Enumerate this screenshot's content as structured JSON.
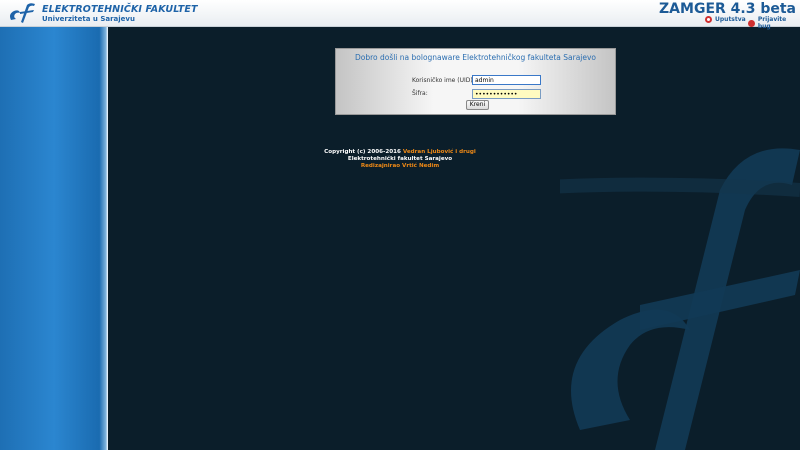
{
  "header": {
    "institution_name": "ELEKTROTEHNIČKI FAKULTET",
    "institution_sub": "Univerziteta u Sarajevu",
    "app_title": "ZAMGER 4.3 beta",
    "help_label": "Uputstva",
    "bug_label": "Prijavite bug"
  },
  "login": {
    "welcome": "Dobro došli na bolognaware Elektrotehničkog fakulteta Sarajevo",
    "username_label": "Korisničko ime (UID):",
    "username_value": "admin",
    "password_label": "Šifra:",
    "password_value": "••••••••••••",
    "submit_label": "Kreni"
  },
  "credits": {
    "copyright_prefix": "Copyright (c) 2006-2016",
    "authors": "Vedran Ljubović i drugi",
    "faculty": "Elektrotehnički fakultet Sarajevo",
    "redesign": "Redizajnirao Vrtić Nedim"
  },
  "colors": {
    "accent": "#1e63a8",
    "highlight": "#f08a16",
    "background": "#0b1e2a"
  }
}
